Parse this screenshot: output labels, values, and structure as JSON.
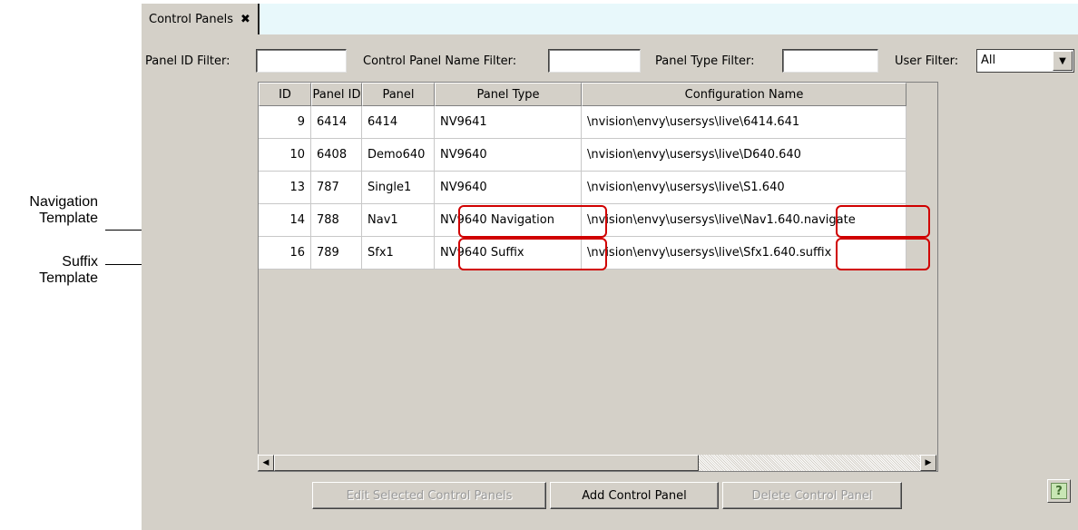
{
  "callouts": [
    {
      "line1": "Navigation",
      "line2": "Template"
    },
    {
      "line1": "Suffix",
      "line2": "Template"
    }
  ],
  "tab": {
    "label": "Control Panels",
    "close": "✖"
  },
  "filters": {
    "panel_id_label": "Panel ID Filter:",
    "panel_id_value": "",
    "name_label": "Control Panel Name Filter:",
    "name_value": "",
    "type_label": "Panel Type Filter:",
    "type_value": "",
    "user_label": "User Filter:",
    "user_value": "All"
  },
  "table": {
    "columns": [
      "ID",
      "Panel ID",
      "Panel",
      "Panel Type",
      "Configuration Name"
    ],
    "rows": [
      [
        "9",
        "6414",
        "6414",
        "NV9641",
        "\\nvision\\envy\\usersys\\live\\6414.641"
      ],
      [
        "10",
        "6408",
        "Demo640",
        "NV9640",
        "\\nvision\\envy\\usersys\\live\\D640.640"
      ],
      [
        "13",
        "787",
        "Single1",
        "NV9640",
        "\\nvision\\envy\\usersys\\live\\S1.640"
      ],
      [
        "14",
        "788",
        "Nav1",
        "NV9640 Navigation",
        "\\nvision\\envy\\usersys\\live\\Nav1.640.navigate"
      ],
      [
        "16",
        "789",
        "Sfx1",
        "NV9640 Suffix",
        "\\nvision\\envy\\usersys\\live\\Sfx1.640.suffix"
      ]
    ]
  },
  "buttons": {
    "edit": "Edit Selected Control Panels",
    "add": "Add Control Panel",
    "delete": "Delete Control Panel",
    "help": "?"
  },
  "colors": {
    "highlight": "#d00000",
    "tab_bar": "#e8f8fb",
    "panel_bg": "#d4d0c8"
  }
}
